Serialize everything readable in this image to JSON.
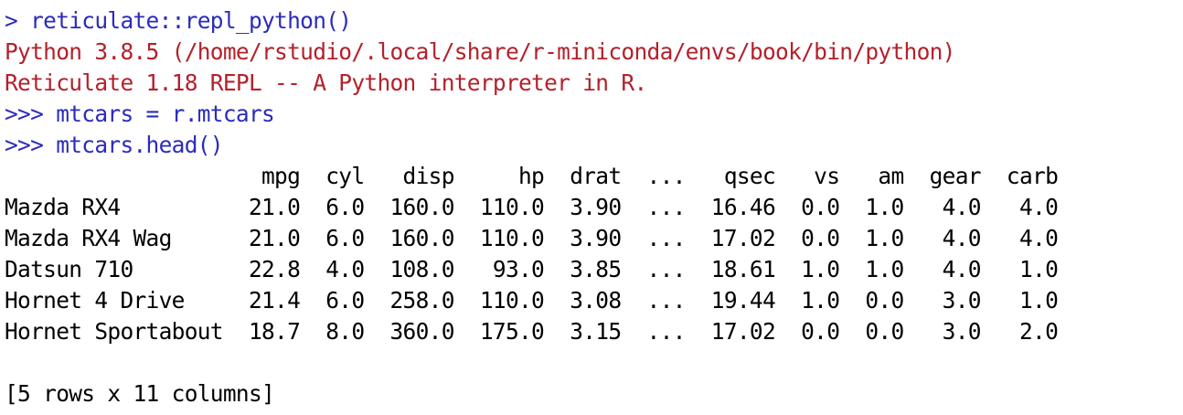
{
  "console": {
    "commands": [
      "> reticulate::repl_python()",
      ">>> mtcars = r.mtcars",
      ">>> mtcars.head()"
    ],
    "messages": [
      "Python 3.8.5 (/home/rstudio/.local/share/r-miniconda/envs/book/bin/python)",
      "Reticulate 1.18 REPL -- A Python interpreter in R."
    ],
    "table": {
      "header": "                    mpg  cyl   disp     hp  drat  ...   qsec   vs   am  gear  carb",
      "rows": [
        "Mazda RX4          21.0  6.0  160.0  110.0  3.90  ...  16.46  0.0  1.0   4.0   4.0",
        "Mazda RX4 Wag      21.0  6.0  160.0  110.0  3.90  ...  17.02  0.0  1.0   4.0   4.0",
        "Datsun 710         22.8  4.0  108.0   93.0  3.85  ...  18.61  1.0  1.0   4.0   1.0",
        "Hornet 4 Drive     21.4  6.0  258.0  110.0  3.08  ...  19.44  1.0  0.0   3.0   1.0",
        "Hornet Sportabout  18.7  8.0  360.0  175.0  3.15  ...  17.02  0.0  0.0   3.0   2.0"
      ],
      "summary": "[5 rows x 11 columns]"
    }
  },
  "colors": {
    "input": "#2b2bbd",
    "message": "#b3212b",
    "output": "#000000",
    "background": "#ffffff"
  }
}
